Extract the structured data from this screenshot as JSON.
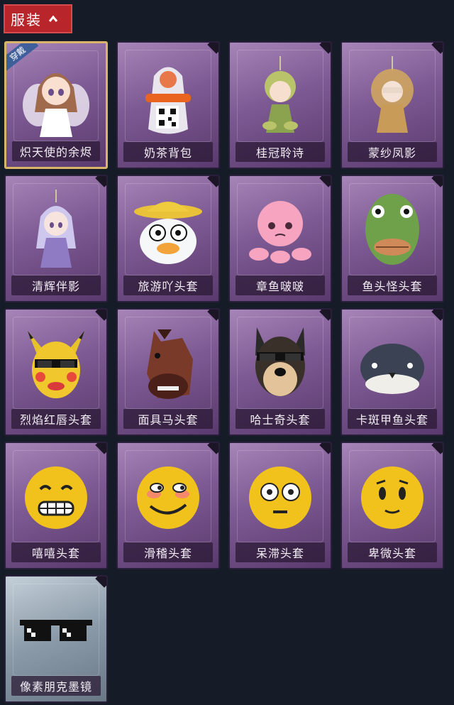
{
  "header": {
    "title": "服装",
    "toggle_icon": "chevron-up-icon"
  },
  "accent_color": "#b8262c",
  "equipped_badge": "穿戴",
  "items": [
    {
      "label": "炽天使的余烬",
      "icon": "angel-figure-icon",
      "equipped": true
    },
    {
      "label": "奶茶背包",
      "icon": "milk-tea-backpack-icon"
    },
    {
      "label": "桂冠聆诗",
      "icon": "laurel-figure-icon"
    },
    {
      "label": "蒙纱凤影",
      "icon": "veiled-phoenix-figure-icon"
    },
    {
      "label": "清辉伴影",
      "icon": "moonlight-figure-icon"
    },
    {
      "label": "旅游吖头套",
      "icon": "duck-hat-mask-icon"
    },
    {
      "label": "章鱼啵啵",
      "icon": "octopus-icon"
    },
    {
      "label": "鱼头怪头套",
      "icon": "fish-head-mask-icon"
    },
    {
      "label": "烈焰红唇头套",
      "icon": "yellow-mouse-mask-icon"
    },
    {
      "label": "面具马头套",
      "icon": "horse-mask-icon"
    },
    {
      "label": "哈士奇头套",
      "icon": "husky-mask-icon"
    },
    {
      "label": "卡斑甲鱼头套",
      "icon": "turtle-mask-icon"
    },
    {
      "label": "嘻嘻头套",
      "icon": "grin-emoji-icon"
    },
    {
      "label": "滑稽头套",
      "icon": "smirk-emoji-icon"
    },
    {
      "label": "呆滞头套",
      "icon": "dazed-emoji-icon"
    },
    {
      "label": "卑微头套",
      "icon": "humble-emoji-icon"
    },
    {
      "label": "像素朋克墨镜",
      "icon": "pixel-sunglasses-icon",
      "silver": true
    }
  ]
}
